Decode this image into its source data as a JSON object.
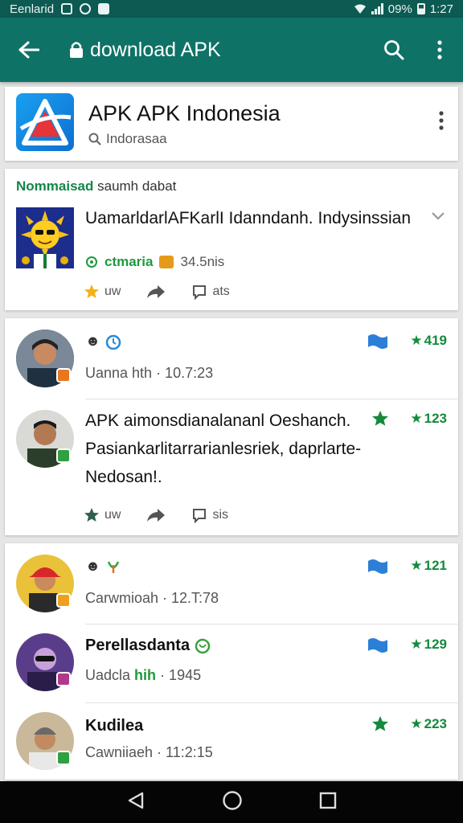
{
  "status_bar": {
    "carrier": "Eenlarid",
    "battery": "09%",
    "time": "1:27"
  },
  "toolbar": {
    "title": "download APK"
  },
  "app": {
    "title": "APK APK Indonesia",
    "subtitle": "Indorasaa"
  },
  "featured": {
    "label_highlight": "Nommaisad",
    "label_rest": "saumh dabat",
    "text": "UamarldarlAFKarlI Idanndanh. Indysinssian",
    "tag": "ctmaria",
    "size": "34.5nis",
    "actions": {
      "like": "uw",
      "share": "",
      "comment": "ats"
    }
  },
  "comments_group1": [
    {
      "name_icons": "",
      "sub": "Uanna hth · 10.7:23",
      "count": "419",
      "show_flag": true,
      "show_star": false
    },
    {
      "text": "APK aimonsdianalananl Oeshanch. Pasiankarlitarrarianlesriek, daprlarte- Nedosan!.",
      "count": "123",
      "show_star": true
    }
  ],
  "actions2": {
    "like": "uw",
    "share": "",
    "comment": "sis"
  },
  "comments_group2": [
    {
      "name": "",
      "sub": "Carwmioah · 12.T:78",
      "count": "121"
    },
    {
      "name": "Perellasdanta",
      "sub_a": "Uadcla",
      "sub_b": "hih",
      "sub_c": "· 1945",
      "count": "129"
    },
    {
      "name": "Kudilea",
      "sub": "Cawniiaeh · 11:2:15",
      "count": "223"
    }
  ],
  "colors": {
    "toolbar": "#0f7266",
    "status_bar": "#0c5a52",
    "accent_green": "#138a3c",
    "flag_blue": "#2b7fd6"
  },
  "icons": [
    "back-arrow-icon",
    "lock-icon",
    "search-icon",
    "more-vert-icon",
    "chevron-down-icon",
    "star-icon",
    "share-icon",
    "comment-icon",
    "flag-icon",
    "nav-back-icon",
    "nav-home-icon",
    "nav-recents-icon"
  ]
}
